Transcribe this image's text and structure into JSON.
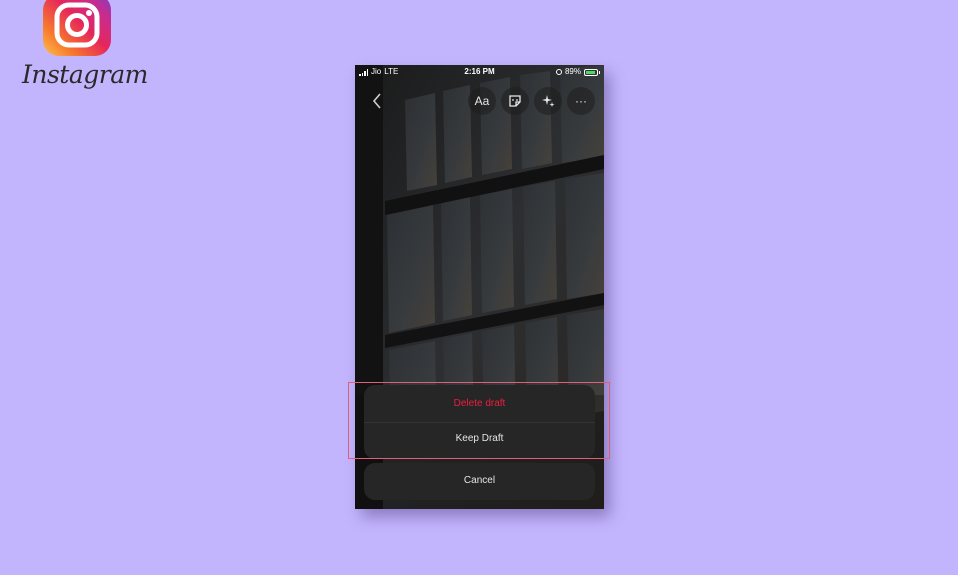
{
  "brand": {
    "wordmark": "Instagram",
    "logo_icon": "instagram-camera-icon"
  },
  "status_bar": {
    "carrier": "Jio",
    "network": "LTE",
    "time": "2:16 PM",
    "battery": "89%"
  },
  "toolbar": {
    "back_icon": "chevron-left-icon",
    "text_label": "Aa",
    "sticker_icon": "sticker-icon",
    "effects_icon": "sparkles-icon",
    "more_label": "···"
  },
  "action_sheet": {
    "delete_label": "Delete draft",
    "keep_label": "Keep Draft",
    "cancel_label": "Cancel"
  },
  "colors": {
    "background": "#c3b5fd",
    "destructive": "#ee1d3f",
    "highlight_border": "#e0607a"
  }
}
